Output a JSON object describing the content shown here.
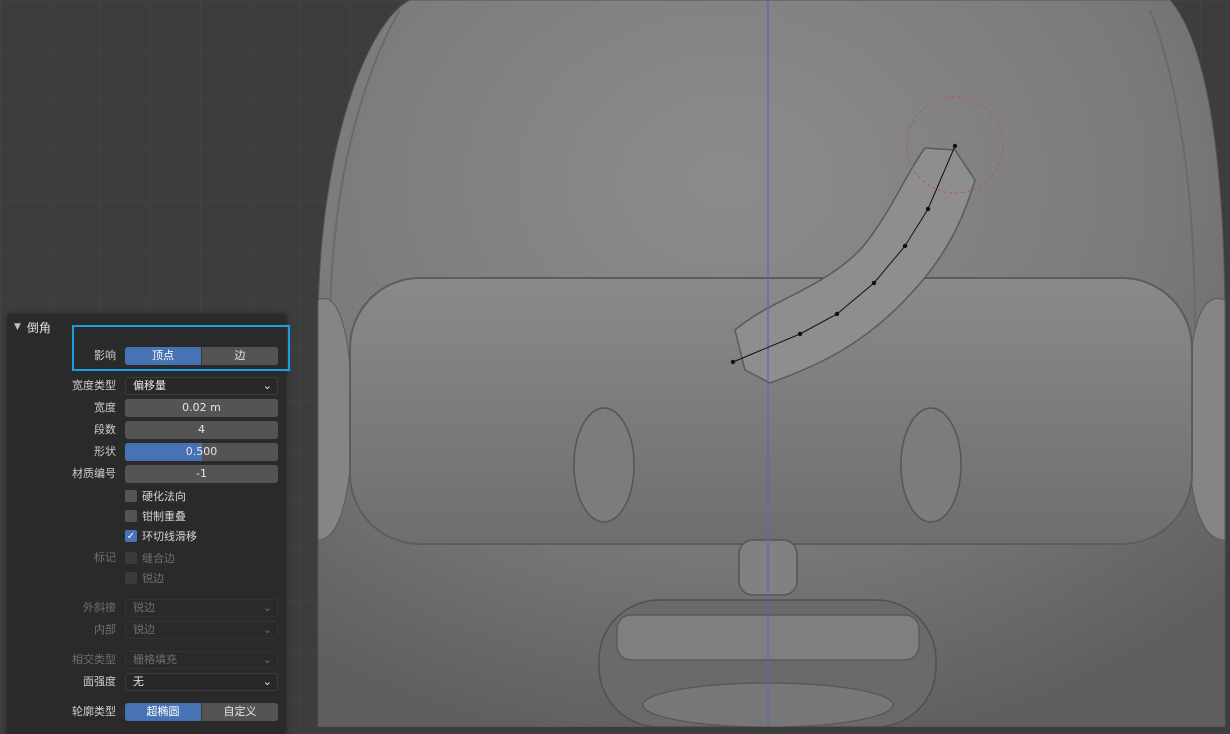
{
  "panel": {
    "title": "倒角",
    "affect": {
      "label": "影响",
      "options": [
        "顶点",
        "边"
      ],
      "selected": "顶点"
    },
    "width_type": {
      "label": "宽度类型",
      "value": "偏移量"
    },
    "width": {
      "label": "宽度",
      "value": "0.02 m"
    },
    "segments": {
      "label": "段数",
      "value": "4"
    },
    "shape": {
      "label": "形状",
      "value": "0.500",
      "fraction": 0.5
    },
    "material": {
      "label": "材质编号",
      "value": "-1"
    },
    "harden_normals": {
      "label": "硬化法向",
      "checked": false
    },
    "clamp_overlap": {
      "label": "钳制重叠",
      "checked": false
    },
    "loop_slide": {
      "label": "环切线滑移",
      "checked": true
    },
    "mark": {
      "label": "标记",
      "seam": "缝合边",
      "sharp": "锐边"
    },
    "miter_outer": {
      "label": "外斜接",
      "value": "锐边"
    },
    "miter_inner": {
      "label": "内部",
      "value": "锐边"
    },
    "intersection_type": {
      "label": "相交类型",
      "value": "栅格填充"
    },
    "face_strength": {
      "label": "面强度",
      "value": "无"
    },
    "profile_type": {
      "label": "轮廓类型",
      "options": [
        "超椭圆",
        "自定义"
      ],
      "selected": "超椭圆"
    }
  },
  "colors": {
    "accent": "#4772b3",
    "highlight": "#1a9fe0",
    "panel_bg": "#2a2a2a",
    "viewport_bg": "#3d3d3d"
  }
}
